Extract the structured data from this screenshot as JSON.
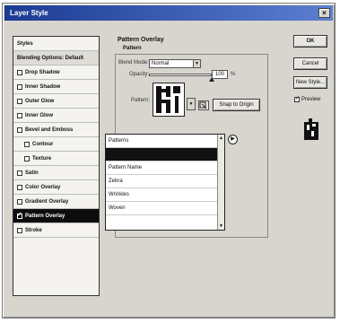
{
  "window": {
    "title": "Layer Style",
    "close": "×"
  },
  "styles_list": {
    "items": [
      {
        "label": "Styles",
        "checkbox": false,
        "indent": false,
        "selected": false,
        "header": false
      },
      {
        "label": "Blending Options: Default",
        "checkbox": false,
        "indent": false,
        "selected": false,
        "header": true
      },
      {
        "label": "Drop Shadow",
        "checkbox": true,
        "indent": false,
        "selected": false,
        "header": false
      },
      {
        "label": "Inner Shadow",
        "checkbox": true,
        "indent": false,
        "selected": false,
        "header": false
      },
      {
        "label": "Outer Glow",
        "checkbox": true,
        "indent": false,
        "selected": false,
        "header": false
      },
      {
        "label": "Inner Glow",
        "checkbox": true,
        "indent": false,
        "selected": false,
        "header": false
      },
      {
        "label": "Bevel and Emboss",
        "checkbox": true,
        "indent": false,
        "selected": false,
        "header": false
      },
      {
        "label": "Contour",
        "checkbox": true,
        "indent": true,
        "selected": false,
        "header": false
      },
      {
        "label": "Texture",
        "checkbox": true,
        "indent": true,
        "selected": false,
        "header": false
      },
      {
        "label": "Satin",
        "checkbox": true,
        "indent": false,
        "selected": false,
        "header": false
      },
      {
        "label": "Color Overlay",
        "checkbox": true,
        "indent": false,
        "selected": false,
        "header": false
      },
      {
        "label": "Gradient Overlay",
        "checkbox": true,
        "indent": false,
        "selected": false,
        "header": false
      },
      {
        "label": "Pattern Overlay",
        "checkbox": true,
        "indent": false,
        "selected": true,
        "header": false
      },
      {
        "label": "Stroke",
        "checkbox": true,
        "indent": false,
        "selected": false,
        "header": false
      }
    ]
  },
  "pattern_overlay": {
    "section_title": "Pattern Overlay",
    "group_title": "Pattern",
    "blend_mode_label": "Blend Mode:",
    "blend_mode_value": "Normal",
    "opacity_label": "Opacity:",
    "opacity_value": "100",
    "opacity_fraction": 1.0,
    "pattern_label": "Pattern:",
    "snap_button": "Snap to Origin"
  },
  "picker": {
    "rows": [
      "Patterns",
      "",
      "Pattern Name",
      "Zebra",
      "Wrinkles",
      "Woven"
    ],
    "selected_index": 1,
    "menu": "▶"
  },
  "buttons": {
    "ok": "OK",
    "cancel": "Cancel",
    "new_style": "New Style...",
    "preview_label": "Preview"
  },
  "colors": {
    "selected_bg": "#0d0d0d",
    "title_bar": "#1c3a93",
    "dialog_bg": "#d8d5ce"
  }
}
